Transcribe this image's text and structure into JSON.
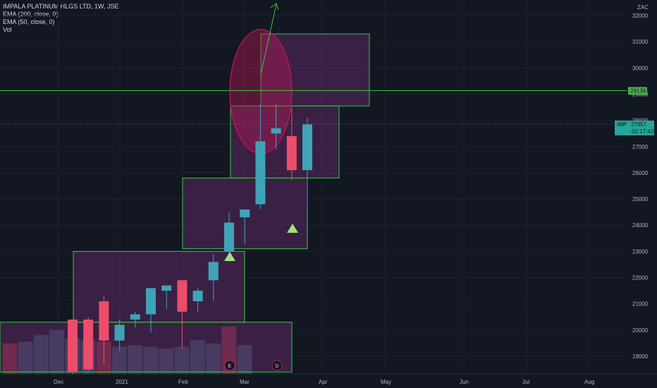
{
  "header": {
    "title": "IMPALA PLATINUM HLGS LTD, 1W, JSE",
    "indicators": [
      "EMA (200, close, 0)",
      "EMA (50, close, 0)",
      "Vol"
    ]
  },
  "chart_data": {
    "type": "candlestick",
    "currency": "ZAC",
    "y_ticks": [
      19000,
      20000,
      21000,
      22000,
      23000,
      24000,
      25000,
      26000,
      27000,
      28000,
      29000,
      30000,
      31000,
      32000
    ],
    "x_labels": [
      "Dec",
      "2021",
      "Feb",
      "Mar",
      "Apr",
      "May",
      "Jun",
      "Jul",
      "Aug"
    ],
    "candles": [
      {
        "o": 20400,
        "h": 20400,
        "l": 18300,
        "c": 18400
      },
      {
        "o": 20400,
        "h": 20500,
        "l": 18400,
        "c": 18500
      },
      {
        "o": 21100,
        "h": 21300,
        "l": 18700,
        "c": 19600
      },
      {
        "o": 19600,
        "h": 20400,
        "l": 19200,
        "c": 20200
      },
      {
        "o": 20400,
        "h": 20700,
        "l": 20100,
        "c": 20600
      },
      {
        "o": 20600,
        "h": 21600,
        "l": 19900,
        "c": 21600
      },
      {
        "o": 21500,
        "h": 21700,
        "l": 20800,
        "c": 21700
      },
      {
        "o": 21900,
        "h": 21900,
        "l": 19300,
        "c": 20700
      },
      {
        "o": 21100,
        "h": 21600,
        "l": 20700,
        "c": 21500
      },
      {
        "o": 21900,
        "h": 22900,
        "l": 21100,
        "c": 22600
      },
      {
        "o": 23000,
        "h": 24500,
        "l": 22600,
        "c": 24100
      },
      {
        "o": 24300,
        "h": 24600,
        "l": 23300,
        "c": 24600
      },
      {
        "o": 24800,
        "h": 28600,
        "l": 24600,
        "c": 27200
      },
      {
        "o": 27500,
        "h": 28600,
        "l": 26900,
        "c": 27700
      },
      {
        "o": 27400,
        "h": 28500,
        "l": 25700,
        "c": 26100
      },
      {
        "o": 26100,
        "h": 28100,
        "l": 24600,
        "c": 27850
      }
    ],
    "volume": [
      {
        "h": 18,
        "down": true
      },
      {
        "h": 19,
        "down": false
      },
      {
        "h": 23,
        "down": false
      },
      {
        "h": 26,
        "down": false
      },
      {
        "h": 21,
        "down": false
      },
      {
        "h": 20,
        "down": false
      },
      {
        "h": 19,
        "down": true
      },
      {
        "h": 16,
        "down": false
      },
      {
        "h": 17,
        "down": false
      },
      {
        "h": 16,
        "down": false
      },
      {
        "h": 15,
        "down": false
      },
      {
        "h": 16,
        "down": false
      },
      {
        "h": 20,
        "down": false
      },
      {
        "h": 18,
        "down": false
      },
      {
        "h": 28,
        "down": true
      },
      {
        "h": 17,
        "down": false
      }
    ],
    "price_lines": [
      {
        "value": 29138,
        "label": "29138"
      },
      {
        "value": 27857,
        "label": "27857",
        "prefix": "IMP",
        "time": "02:17:43"
      }
    ],
    "event_marks": [
      "E",
      "D"
    ],
    "colors": {
      "up": "#26a69a",
      "down": "#ef5350",
      "box_fill": "#6a2c6e",
      "box_stroke": "#2ecc40",
      "grid": "#1e222d",
      "ellipse": "#c2185b"
    }
  }
}
